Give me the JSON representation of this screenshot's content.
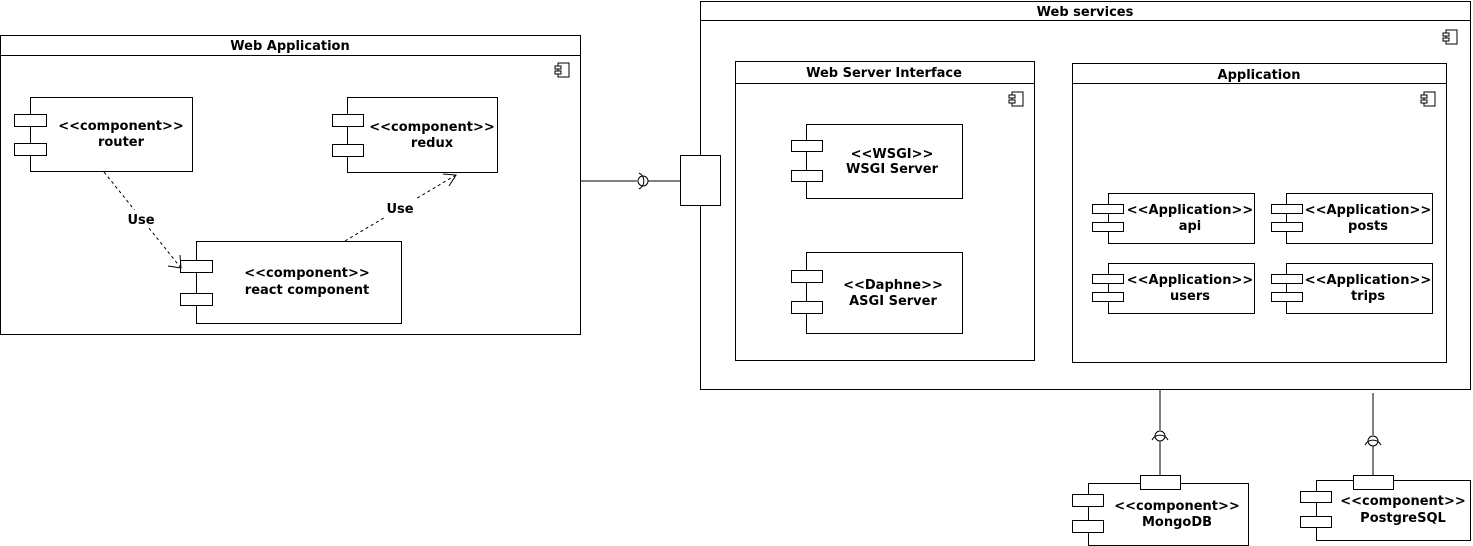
{
  "packages": {
    "web_application": "Web Application",
    "web_services": "Web services",
    "web_server_interface": "Web Server Interface",
    "application": "Application"
  },
  "components": {
    "router": {
      "stereotype": "<<component>>",
      "name": "router"
    },
    "redux": {
      "stereotype": "<<component>>",
      "name": "redux"
    },
    "react_component": {
      "stereotype": "<<component>>",
      "name": "react component"
    },
    "wsgi_server": {
      "stereotype": "<<WSGI>>",
      "name": "WSGI Server"
    },
    "asgi_server": {
      "stereotype": "<<Daphne>>",
      "name": "ASGI Server"
    },
    "api": {
      "stereotype": "<<Application>>",
      "name": "api"
    },
    "posts": {
      "stereotype": "<<Application>>",
      "name": "posts"
    },
    "users": {
      "stereotype": "<<Application>>",
      "name": "users"
    },
    "trips": {
      "stereotype": "<<Application>>",
      "name": "trips"
    },
    "mongodb": {
      "stereotype": "<<component>>",
      "name": "MongoDB"
    },
    "postgresql": {
      "stereotype": "<<component>>",
      "name": "PostgreSQL"
    }
  },
  "edges": {
    "router_to_react": "Use",
    "react_to_redux": "Use"
  }
}
